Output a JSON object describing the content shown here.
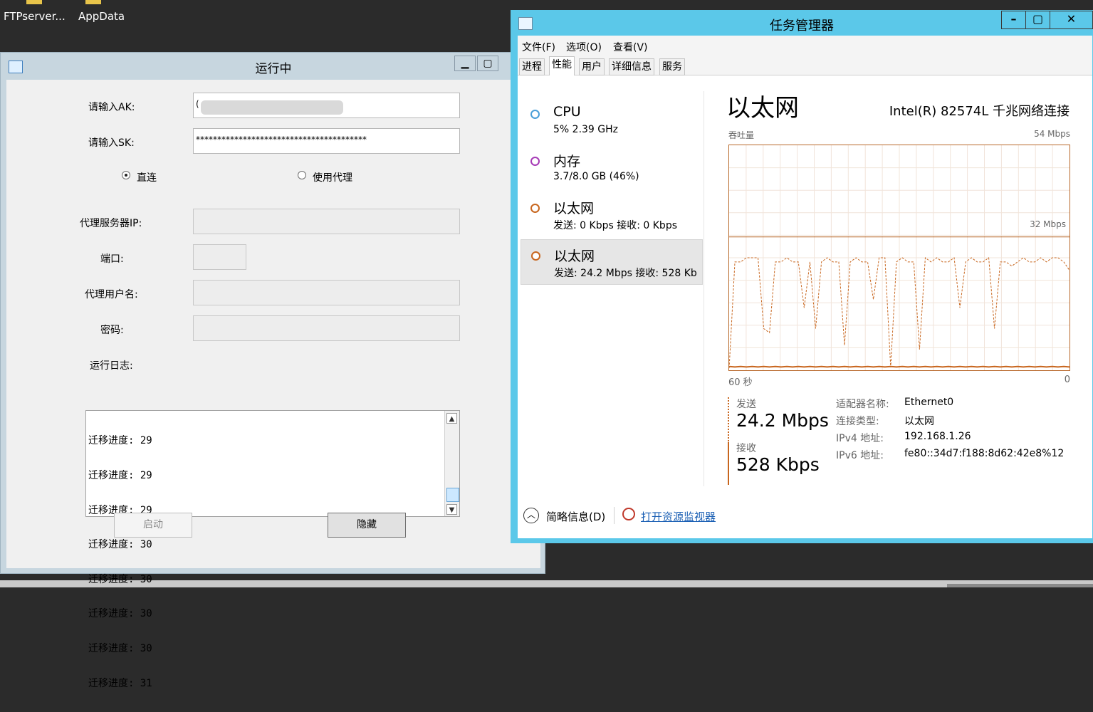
{
  "desktop": {
    "icons": [
      {
        "label": "FTPserver..."
      },
      {
        "label": "AppData"
      }
    ]
  },
  "app_window": {
    "title": "运行中",
    "ak_label": "请输入AK:",
    "ak_value": "(",
    "sk_label": "请输入SK:",
    "sk_value": "****************************************",
    "radio_direct": "直连",
    "radio_proxy": "使用代理",
    "proxy_ip_label": "代理服务器IP:",
    "port_label": "端口:",
    "proxy_user_label": "代理用户名:",
    "password_label": "密码:",
    "log_label": "运行日志:",
    "log_lines": [
      "迁移进度: 29",
      "迁移进度: 29",
      "迁移进度: 29",
      "迁移进度: 30",
      "迁移进度: 30",
      "迁移进度: 30",
      "迁移进度: 30",
      "迁移进度: 31"
    ],
    "start_button": "启动",
    "hide_button": "隐藏"
  },
  "task_manager": {
    "title": "任务管理器",
    "menus": [
      "文件(F)",
      "选项(O)",
      "查看(V)"
    ],
    "tabs": [
      "进程",
      "性能",
      "用户",
      "详细信息",
      "服务"
    ],
    "active_tab": "性能",
    "resources": [
      {
        "name": "CPU",
        "sub": "5%  2.39 GHz",
        "color": "#4a9fd8"
      },
      {
        "name": "内存",
        "sub": "3.7/8.0 GB (46%)",
        "color": "#a63bb6"
      },
      {
        "name": "以太网",
        "sub": "发送: 0 Kbps 接收: 0 Kbps",
        "color": "#c8661e"
      },
      {
        "name": "以太网",
        "sub": "发送: 24.2 Mbps 接收: 528 Kb",
        "color": "#c8661e"
      }
    ],
    "detail": {
      "title": "以太网",
      "adapter": "Intel(R) 82574L 千兆网络连接",
      "throughput_label": "吞吐量",
      "max_label": "54 Mbps",
      "mid_label": "32 Mbps",
      "time_left": "60 秒",
      "time_right": "0",
      "send_label": "发送",
      "send_value": "24.2 Mbps",
      "recv_label": "接收",
      "recv_value": "528 Kbps",
      "props": [
        {
          "key": "适配器名称:",
          "value": "Ethernet0"
        },
        {
          "key": "连接类型:",
          "value": "以太网"
        },
        {
          "key": "IPv4 地址:",
          "value": "192.168.1.26"
        },
        {
          "key": "IPv6 地址:",
          "value": "fe80::34d7:f188:8d62:42e8%12"
        }
      ]
    },
    "footer": {
      "fewer_details": "简略信息(D)",
      "open_monitor": "打开资源监视器"
    },
    "graph_line_color": "#c8661e"
  },
  "chart_data": {
    "type": "line",
    "ylim": [
      0,
      54
    ],
    "series": [
      {
        "values": [
          0.9,
          0.8,
          0.9,
          0.8,
          0.9,
          0.8,
          0.9,
          0.8,
          0.9,
          0.8,
          0.9,
          0.8,
          0.9,
          0.8,
          0.9,
          0.8,
          0.9,
          0.8,
          0.9,
          0.8,
          0.9,
          0.8,
          0.9,
          0.8,
          0.9,
          0.8,
          0.9,
          0.8,
          0.9,
          0.8,
          0.9,
          0.8,
          0.9,
          0.8,
          0.9,
          0.8,
          0.9,
          0.8,
          0.9,
          0.8,
          0.9,
          0.8,
          0.9,
          0.8,
          0.9,
          0.8,
          0.9,
          0.8,
          0.9,
          0.8,
          0.9,
          0.8,
          0.9,
          0.8,
          0.9,
          0.8,
          0.9,
          0.8,
          0.9,
          0.8
        ]
      },
      {
        "values": [
          0.5,
          26,
          26,
          27,
          27,
          27,
          10,
          9,
          26,
          26,
          27,
          26,
          26,
          15,
          26,
          10,
          26,
          27,
          26,
          26,
          6,
          26,
          27,
          26,
          26,
          17,
          27,
          27,
          0.7,
          26,
          27,
          26,
          26,
          5,
          27,
          26,
          27,
          26,
          26,
          27,
          15,
          26,
          27,
          26,
          26,
          27,
          10,
          26,
          26,
          25,
          26,
          27,
          26,
          26,
          27,
          26,
          27,
          27,
          26,
          24
        ]
      }
    ]
  }
}
